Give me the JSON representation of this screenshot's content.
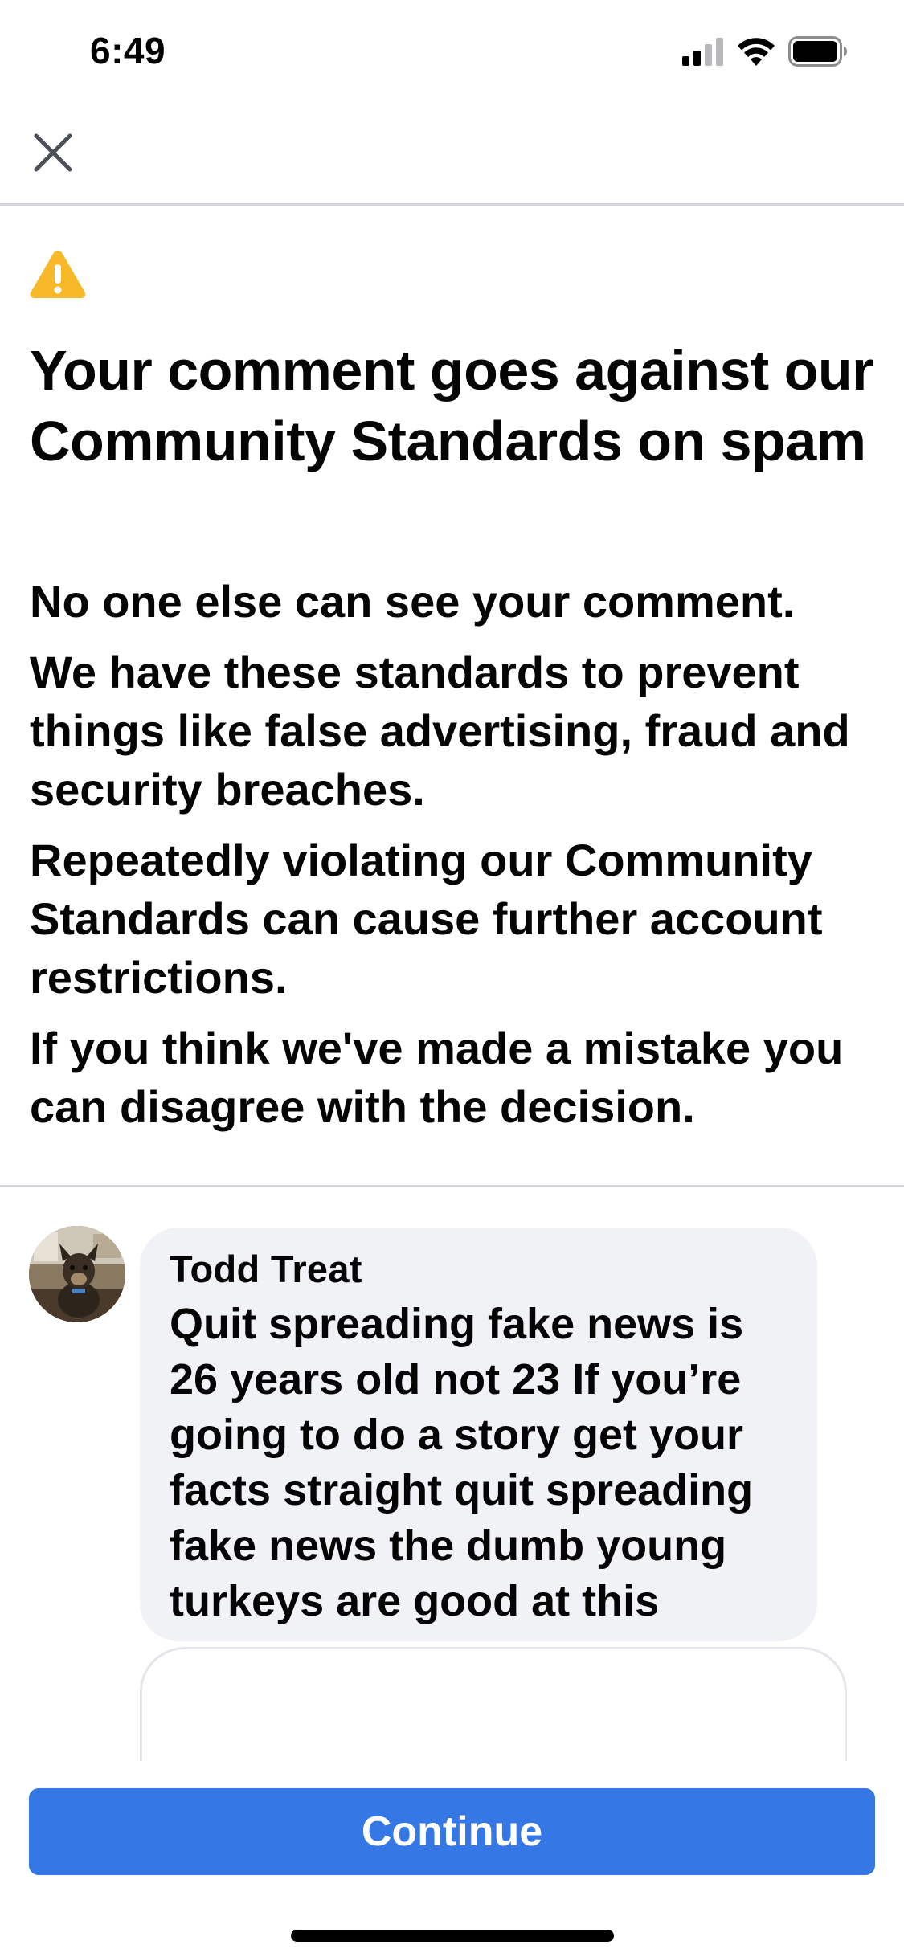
{
  "status_bar": {
    "time": "6:49",
    "signal_icon": "cellular-signal-icon",
    "wifi_icon": "wifi-icon",
    "battery_icon": "battery-icon"
  },
  "nav": {
    "close_icon": "close-icon"
  },
  "notice": {
    "warning_icon": "warning-icon",
    "warning_color": "#f7b928",
    "title": "Your comment goes against our Community Standards on spam",
    "paragraphs": [
      "No one else can see your comment.",
      "We have these standards to prevent things like false advertising, fraud and security breaches.",
      "Repeatedly violating our Community Standards can cause further account restrictions.",
      "If you think we've made a mistake you can disagree with the decision."
    ]
  },
  "comment": {
    "author": "Todd Treat",
    "text": "Quit spreading fake news is 26 years old not 23 If you’re going to do a story get your facts straight quit spreading fake news the dumb young turkeys are good at this"
  },
  "footer": {
    "continue_label": "Continue",
    "button_color": "#3578e5"
  }
}
